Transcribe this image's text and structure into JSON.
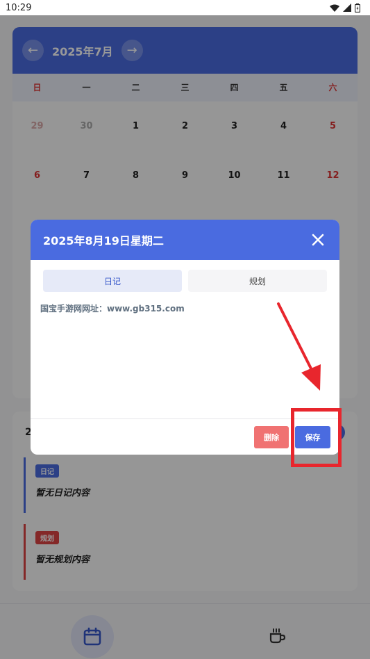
{
  "status_bar": {
    "time": "10:29"
  },
  "calendar": {
    "month_title": "2025年7月",
    "weekdays": [
      "日",
      "一",
      "二",
      "三",
      "四",
      "五",
      "六"
    ],
    "week1": [
      "29",
      "30",
      "1",
      "2",
      "3",
      "4",
      "5"
    ],
    "week2": [
      "6",
      "7",
      "8",
      "9",
      "10",
      "11",
      "12"
    ]
  },
  "detail": {
    "date_prefix": "2",
    "diary_tag": "日记",
    "diary_empty": "暂无日记内容",
    "plan_tag": "规划",
    "plan_empty": "暂无规划内容"
  },
  "modal": {
    "title": "2025年8月19日星期二",
    "tabs": [
      {
        "label": "日记",
        "active": true
      },
      {
        "label": "规划",
        "active": false
      }
    ],
    "content": "国宝手游网网址：www.gb315.com",
    "delete_label": "删除",
    "save_label": "保存"
  },
  "colors": {
    "accent": "#4a6be0",
    "danger": "#f07272",
    "annotation": "#e8262d"
  }
}
